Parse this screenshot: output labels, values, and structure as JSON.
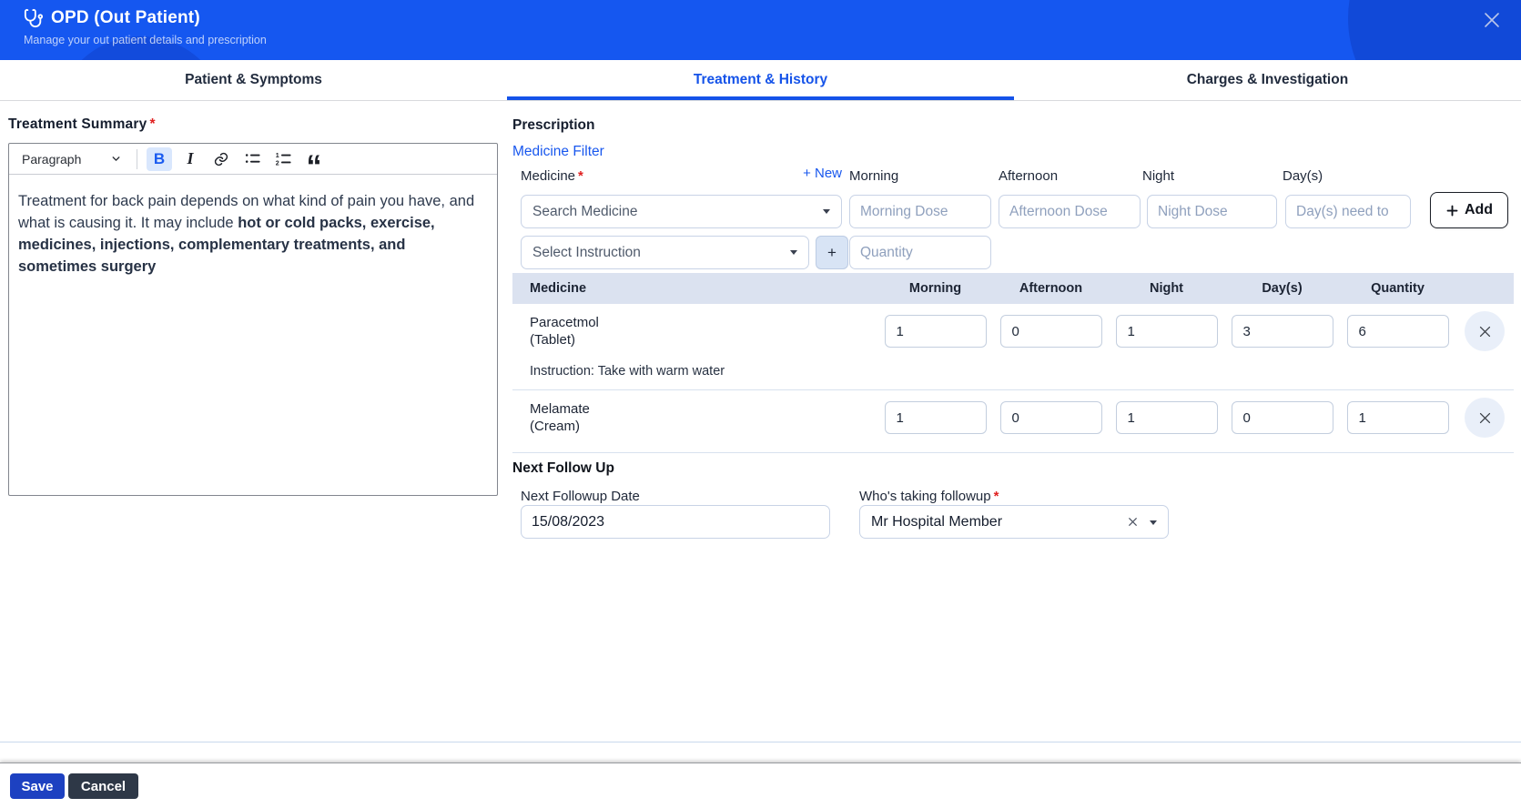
{
  "header": {
    "title": "OPD (Out Patient)",
    "subtitle": "Manage your out patient details and prescription"
  },
  "tabs": [
    {
      "label": "Patient & Symptoms"
    },
    {
      "label": "Treatment & History"
    },
    {
      "label": "Charges & Investigation"
    }
  ],
  "treatment_summary": {
    "label": "Treatment Summary",
    "required_mark": "*",
    "toolbar": {
      "paragraph": "Paragraph",
      "bold": "B",
      "italic": "I",
      "quote": "“"
    },
    "text_normal": "Treatment for back pain depends on what kind of pain you have, and what is causing it. It may include ",
    "text_bold": "hot or cold packs, exercise, medicines, injections, complementary treatments, and sometimes surgery"
  },
  "prescription": {
    "heading": "Prescription",
    "filter_link": "Medicine Filter",
    "medicine_label": "Medicine",
    "required_mark": "*",
    "new_link": "+ New",
    "labels": {
      "morning": "Morning",
      "afternoon": "Afternoon",
      "night": "Night",
      "days": "Day(s)"
    },
    "placeholders": {
      "search": "Search Medicine",
      "morning": "Morning Dose",
      "afternoon": "Afternoon Dose",
      "night": "Night Dose",
      "days": "Day(s) need to",
      "instruction": "Select Instruction",
      "quantity": "Quantity"
    },
    "plus_button": "+",
    "add_button": "Add",
    "table": {
      "headers": [
        "Medicine",
        "Morning",
        "Afternoon",
        "Night",
        "Day(s)",
        "Quantity"
      ],
      "rows": [
        {
          "name": "Paracetmol",
          "form": "(Tablet)",
          "morning": "1",
          "afternoon": "0",
          "night": "1",
          "days": "3",
          "quantity": "6",
          "instruction": "Instruction: Take with warm water"
        },
        {
          "name": "Melamate",
          "form": "(Cream)",
          "morning": "1",
          "afternoon": "0",
          "night": "1",
          "days": "0",
          "quantity": "1"
        }
      ]
    }
  },
  "next_follow_up": {
    "heading": "Next Follow Up",
    "date_label": "Next Followup Date",
    "date_value": "15/08/2023",
    "who_label": "Who's taking followup",
    "required_mark": "*",
    "who_value": "Mr Hospital Member"
  },
  "footer": {
    "save": "Save",
    "cancel": "Cancel"
  },
  "colors": {
    "header_blue": "#1557f0",
    "accent_blue": "#1553e9",
    "save_blue": "#1d41c1",
    "cancel_dark": "#2e3847",
    "table_header_bg": "#dbe2f0"
  }
}
